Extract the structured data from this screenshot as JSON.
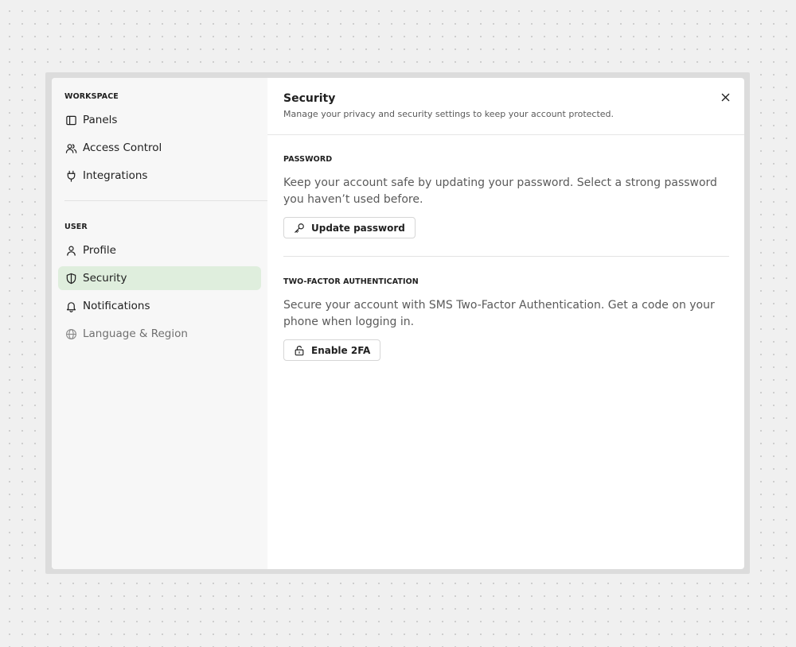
{
  "sidebar": {
    "groups": [
      {
        "label": "WORKSPACE",
        "items": [
          {
            "label": "Panels",
            "icon": "panel-icon"
          },
          {
            "label": "Access Control",
            "icon": "users-icon"
          },
          {
            "label": "Integrations",
            "icon": "plug-icon"
          }
        ]
      },
      {
        "label": "USER",
        "items": [
          {
            "label": "Profile",
            "icon": "user-icon"
          },
          {
            "label": "Security",
            "icon": "shield-icon",
            "active": true
          },
          {
            "label": "Notifications",
            "icon": "bell-icon"
          },
          {
            "label": "Language & Region",
            "icon": "globe-icon",
            "muted": true
          }
        ]
      }
    ]
  },
  "header": {
    "title": "Security",
    "subtitle": "Manage your privacy and security settings to keep your account protected.",
    "close_icon": "close-icon"
  },
  "sections": {
    "password": {
      "title": "PASSWORD",
      "description": "Keep your account safe by updating your password. Select a strong password you haven’t used before.",
      "button_label": "Update password",
      "button_icon": "key-icon"
    },
    "two_factor": {
      "title": "TWO-FACTOR AUTHENTICATION",
      "description": "Secure your account with SMS Two-Factor Authentication. Get a code on your phone when logging in.",
      "button_label": "Enable 2FA",
      "button_icon": "unlock-icon"
    }
  },
  "colors": {
    "active_item_bg": "#dfeedd",
    "sidebar_bg": "#f7f7f7",
    "muted_text": "#707070"
  }
}
